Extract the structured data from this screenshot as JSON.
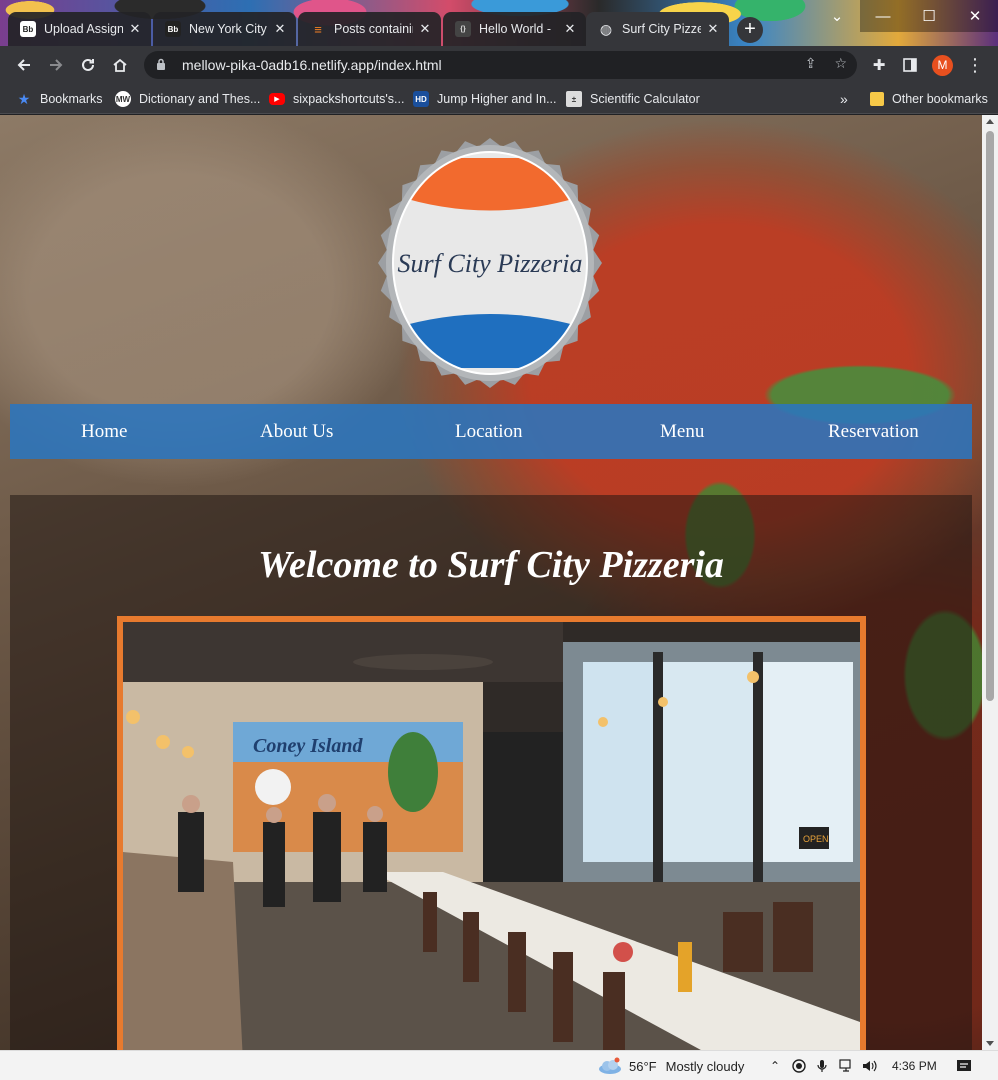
{
  "browser": {
    "tabs": [
      {
        "icon": "Bb",
        "title": "Upload Assignm",
        "active": false
      },
      {
        "icon": "Bb",
        "title": "New York City",
        "active": false
      },
      {
        "icon": "stack",
        "title": "Posts containin",
        "active": false
      },
      {
        "icon": "code",
        "title": "Hello World -",
        "active": false
      },
      {
        "icon": "globe",
        "title": "Surf City Pizzer",
        "active": true
      }
    ],
    "new_tab": "+",
    "window_controls": {
      "chevron": "⌄",
      "minimize": "—",
      "maximize": "☐",
      "close": "✕"
    },
    "url": "mellow-pika-0adb16.netlify.app/index.html",
    "profile_initial": "M",
    "bookmarks": [
      {
        "label": "Bookmarks",
        "icon": "star-icon"
      },
      {
        "label": "Dictionary and Thes...",
        "icon": "MW"
      },
      {
        "label": "sixpackshortcuts's...",
        "icon": "youtube-icon"
      },
      {
        "label": "Jump Higher and In...",
        "icon": "HD"
      },
      {
        "label": "Scientific Calculator",
        "icon": "calculator-icon"
      }
    ],
    "bookmarks_overflow": "»",
    "other_bookmarks": "Other bookmarks"
  },
  "site": {
    "logo_text": "Surf City Pizzeria",
    "nav": [
      "Home",
      "About Us",
      "Location",
      "Menu",
      "Reservation"
    ],
    "heading": "Welcome to Surf City Pizzeria",
    "photo_sign_text": "Coney Island",
    "photo_open_sign": "OPEN",
    "colors": {
      "nav_blue": "#2b75be",
      "frame_orange": "#e77a2e",
      "logo_orange": "#f26a2e",
      "logo_blue": "#1f6fbf"
    }
  },
  "taskbar": {
    "temperature": "56°F",
    "weather": "Mostly cloudy",
    "time": "4:36 PM"
  }
}
